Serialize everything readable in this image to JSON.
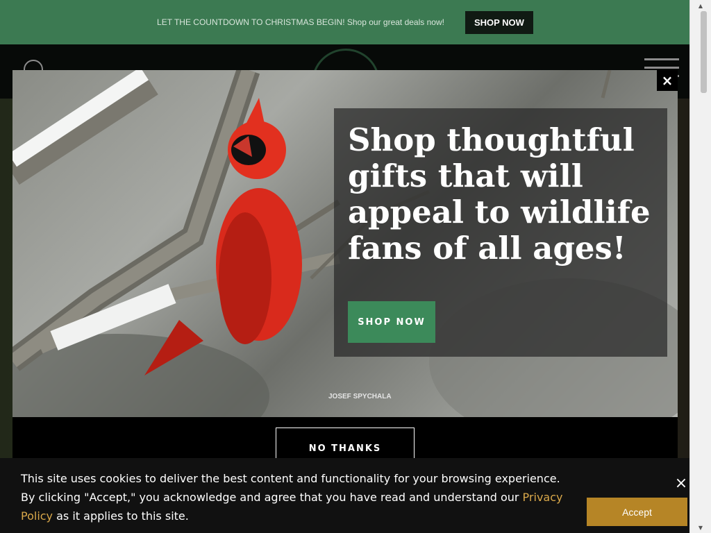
{
  "promo": {
    "text": "LET THE COUNTDOWN TO CHRISTMAS BEGIN! Shop our great deals now!",
    "button": "SHOP NOW"
  },
  "header": {
    "search_icon": "search-icon",
    "menu_icon": "hamburger-menu-icon"
  },
  "modal": {
    "headline": "Shop thoughtful gifts that will appeal to wildlife fans of all ages!",
    "shop_button": "SHOP NOW",
    "photo_credit": "JOSEF SPYCHALA",
    "close_icon": "×",
    "no_thanks": "NO THANKS"
  },
  "cookie": {
    "text_before": "This site uses cookies to deliver the best content and functionality for your browsing experience. By clicking \"Accept,\" you acknowledge and agree that you have read and understand our ",
    "link": "Privacy Policy",
    "text_after": " as it applies to this site.",
    "close": "×",
    "accept": "Accept"
  },
  "scrollbar": {
    "up": "▲",
    "down": "▼"
  },
  "colors": {
    "promo_bg": "#3c7a52",
    "cta_green": "#3c8a5a",
    "accept_gold": "#b68526",
    "link_gold": "#d9a84a"
  }
}
